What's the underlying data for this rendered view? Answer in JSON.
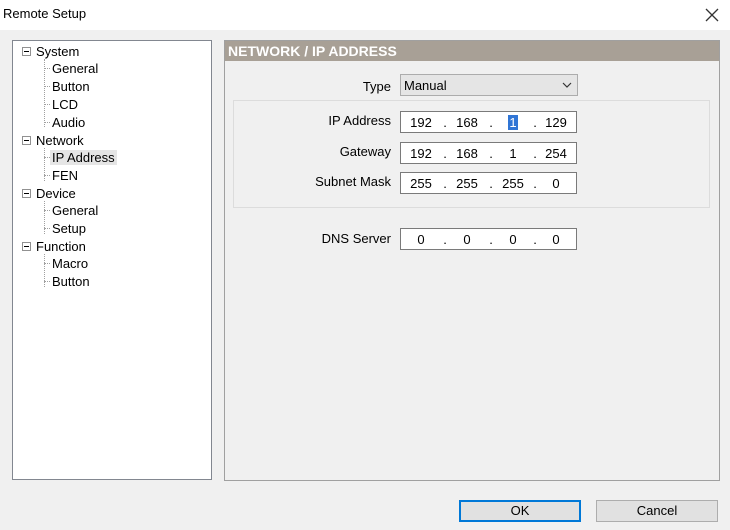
{
  "window": {
    "title": "Remote Setup"
  },
  "tree": {
    "groups": [
      {
        "label": "System",
        "children": [
          "General",
          "Button",
          "LCD",
          "Audio"
        ]
      },
      {
        "label": "Network",
        "children": [
          "IP Address",
          "FEN"
        ]
      },
      {
        "label": "Device",
        "children": [
          "General",
          "Setup"
        ]
      },
      {
        "label": "Function",
        "children": [
          "Macro",
          "Button"
        ]
      }
    ],
    "selected": "IP Address"
  },
  "panel": {
    "header": "NETWORK / IP ADDRESS",
    "type_label": "Type",
    "type_value": "Manual",
    "ip_label": "IP Address",
    "ip": [
      "192",
      "168",
      "1",
      "129"
    ],
    "gateway_label": "Gateway",
    "gateway": [
      "192",
      "168",
      "1",
      "254"
    ],
    "mask_label": "Subnet Mask",
    "mask": [
      "255",
      "255",
      "255",
      "0"
    ],
    "dns_label": "DNS Server",
    "dns": [
      "0",
      "0",
      "0",
      "0"
    ],
    "separator": "."
  },
  "buttons": {
    "ok": "OK",
    "cancel": "Cancel"
  }
}
